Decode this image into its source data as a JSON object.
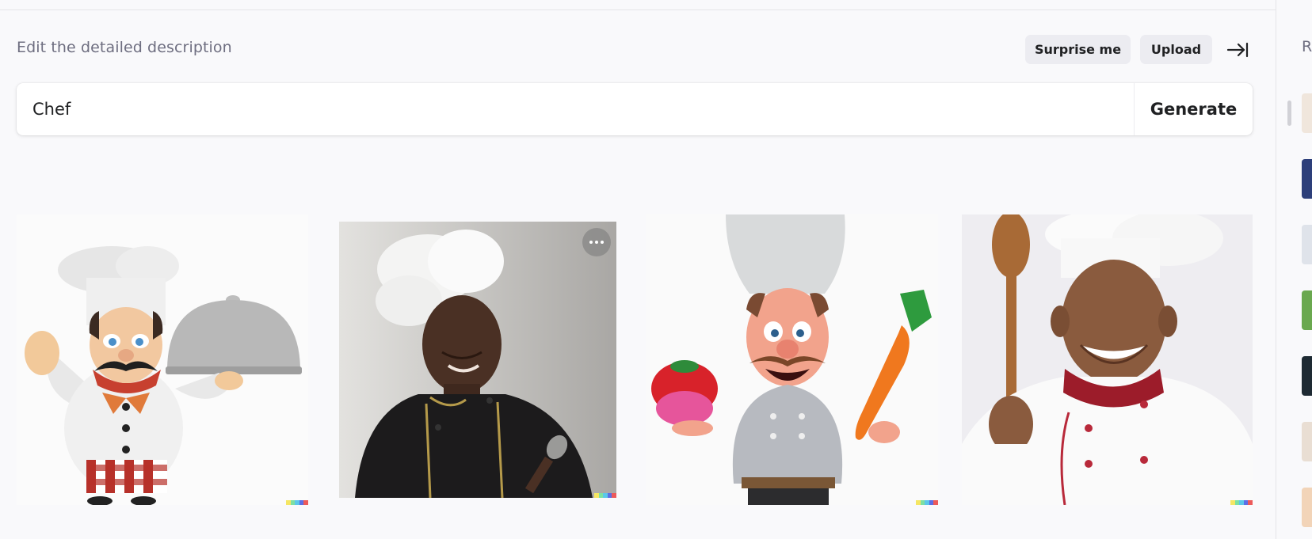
{
  "editor": {
    "description_label": "Edit the detailed description",
    "surprise_label": "Surprise me",
    "upload_label": "Upload",
    "prompt_value": "Chef",
    "prompt_placeholder": "",
    "generate_label": "Generate"
  },
  "results": [
    {
      "name": "cartoon-chef-with-cloche",
      "icon": "image"
    },
    {
      "name": "chef-in-black-jacket",
      "icon": "image"
    },
    {
      "name": "3d-chef-with-tomato-and-carrot",
      "icon": "image"
    },
    {
      "name": "smiling-chef-with-wooden-spoon",
      "icon": "image"
    }
  ],
  "history_panel": {
    "title_initial": "R",
    "thumbnail_count": 8
  },
  "colors": {
    "background": "#f9f9fb",
    "button_bg": "#ececf1",
    "text": "#202123",
    "muted_text": "#6e6e80"
  }
}
